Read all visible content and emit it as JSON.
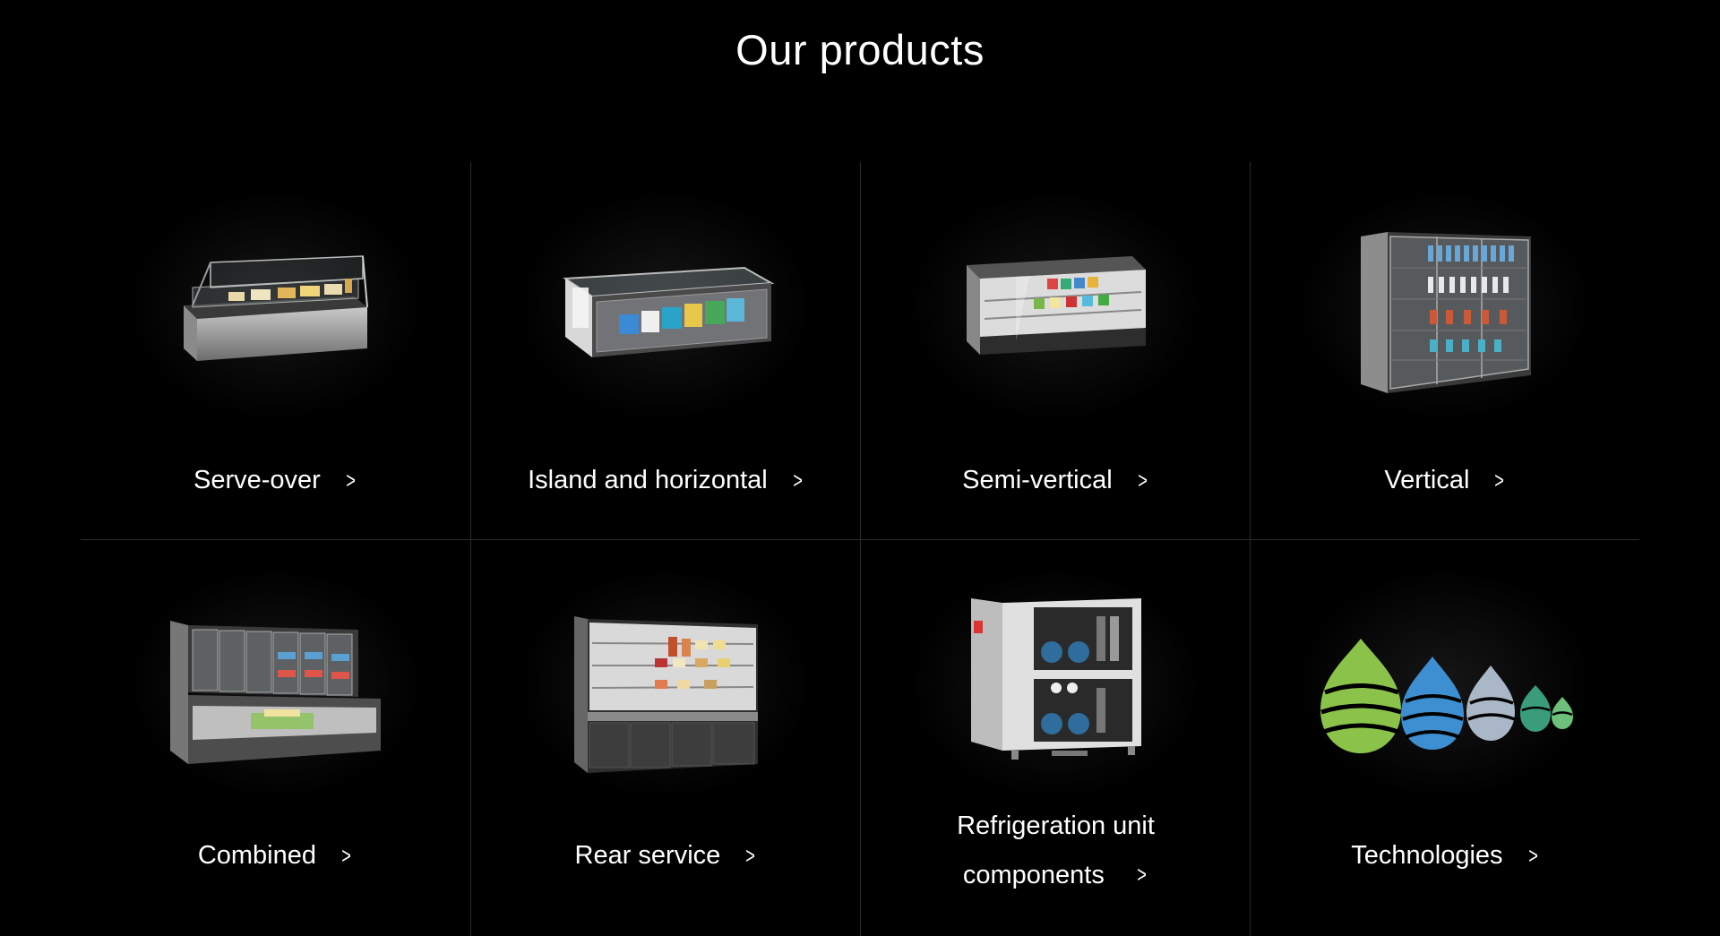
{
  "page": {
    "title": "Our products"
  },
  "products": [
    {
      "label": "Serve-over",
      "icon": "serve-over-counter-image"
    },
    {
      "label": "Island and horizontal",
      "icon": "island-freezer-image"
    },
    {
      "label": "Semi-vertical",
      "icon": "semi-vertical-case-image"
    },
    {
      "label": "Vertical",
      "icon": "vertical-cabinet-image"
    },
    {
      "label": "Combined",
      "icon": "combined-case-image"
    },
    {
      "label": "Rear service",
      "icon": "rear-service-case-image"
    },
    {
      "label_line1": "Refrigeration unit",
      "label_line2": "components",
      "icon": "refrigeration-unit-image"
    },
    {
      "label": "Technologies",
      "icon": "eco-technologies-logo"
    }
  ],
  "colors": {
    "background": "#000000",
    "text": "#ffffff",
    "divider": "#2b2b2b",
    "eco_green": "#8bc34a",
    "eco_blue": "#3d8fd1",
    "eco_gray": "#a9b7c6"
  }
}
